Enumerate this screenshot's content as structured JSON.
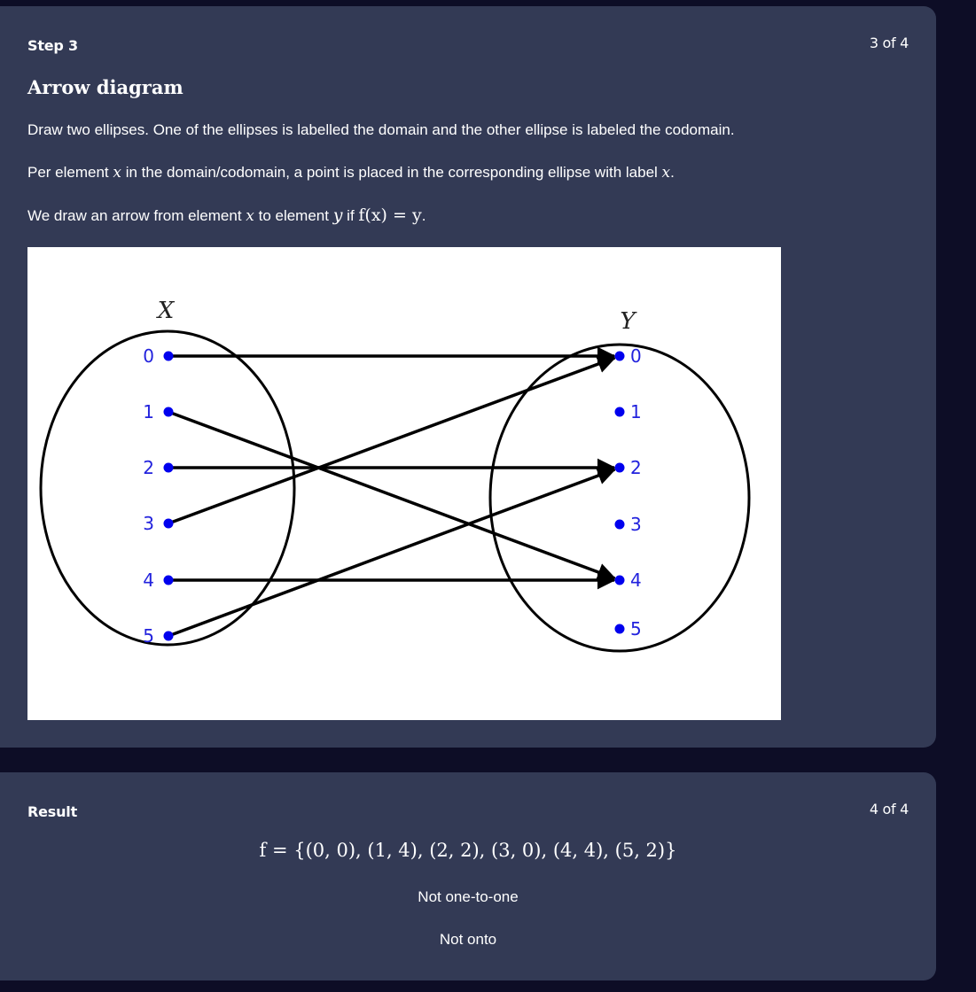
{
  "step": {
    "label": "Step 3",
    "counter": "3 of 4",
    "title": "Arrow diagram",
    "para1": "Draw two ellipses. One of the ellipses is labelled the domain and the other ellipse is labeled the codomain.",
    "para2_before": "Per element ",
    "para2_var": "x",
    "para2_mid": " in the domain/codomain, a point is placed in the corresponding ellipse with label ",
    "para2_var2": "x",
    "para2_end": ".",
    "para3_before": "We draw an arrow from element ",
    "para3_var1": "x",
    "para3_mid": " to element ",
    "para3_var2": "y",
    "para3_if": " if ",
    "para3_formula": "f(x) = y",
    "para3_end": "."
  },
  "diagram": {
    "domain_label": "X",
    "codomain_label": "Y",
    "domain_elements": [
      "0",
      "1",
      "2",
      "3",
      "4",
      "5"
    ],
    "codomain_elements": [
      "0",
      "1",
      "2",
      "3",
      "4",
      "5"
    ],
    "mapping": [
      [
        0,
        0
      ],
      [
        1,
        4
      ],
      [
        2,
        2
      ],
      [
        3,
        0
      ],
      [
        4,
        4
      ],
      [
        5,
        2
      ]
    ],
    "point_color": "#0000ee",
    "label_color": "#2222dd"
  },
  "result": {
    "label": "Result",
    "counter": "4 of 4",
    "formula": "f = {(0, 0), (1, 4), (2, 2), (3, 0), (4, 4), (5, 2)}",
    "line1": "Not one-to-one",
    "line2": "Not onto"
  }
}
